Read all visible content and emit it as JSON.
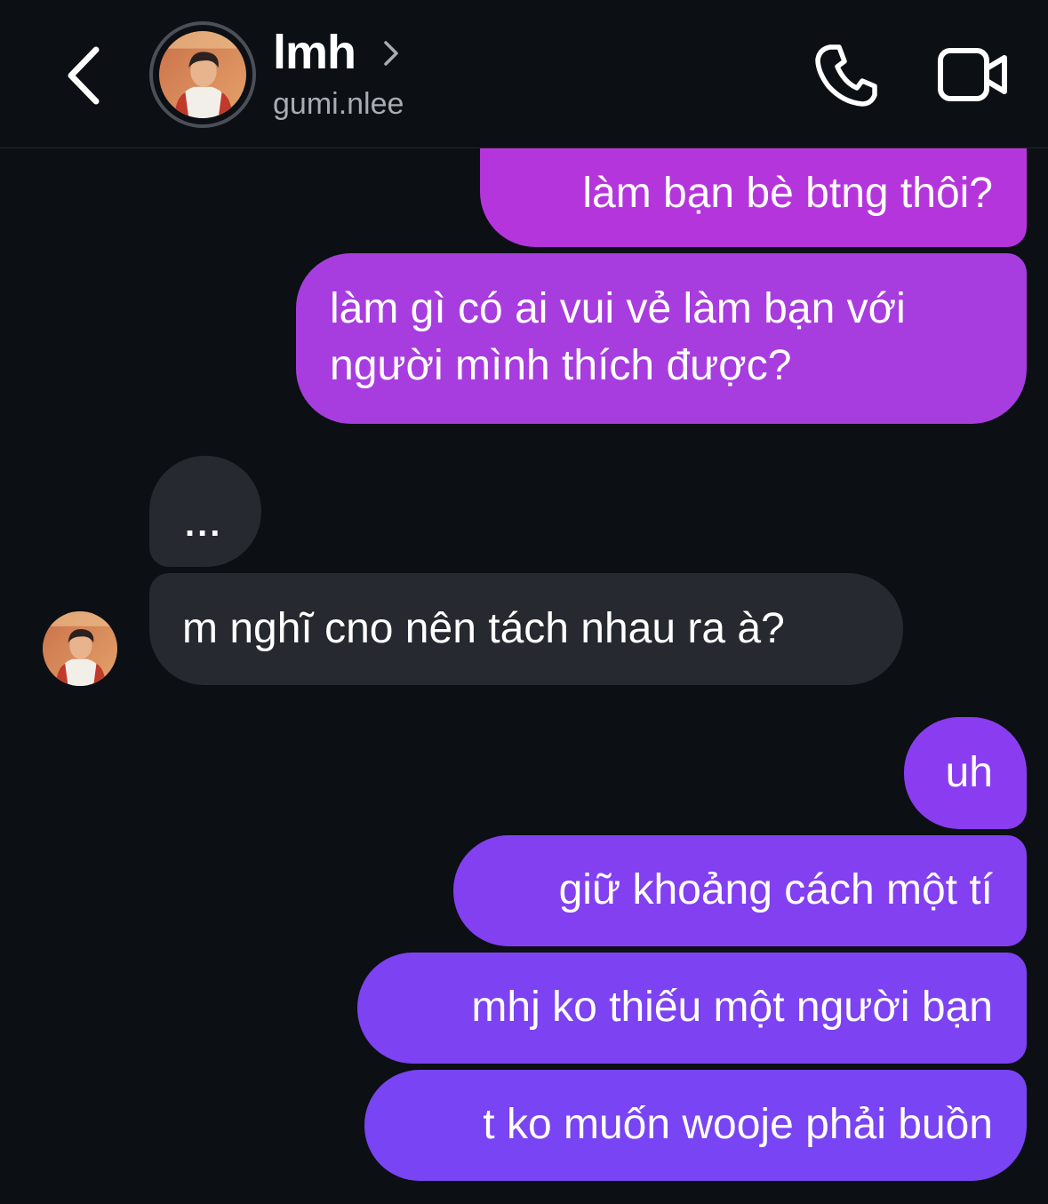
{
  "header": {
    "contact_name": "lmh",
    "contact_handle": "gumi.nlee",
    "back_icon": "chevron-left-icon",
    "name_chevron_icon": "chevron-right-icon",
    "call_icon": "phone-icon",
    "video_icon": "video-camera-icon"
  },
  "colors": {
    "background": "#0c0f14",
    "incoming_bubble": "#26292f",
    "outgoing_gradient_top": "#b535dc",
    "outgoing_gradient_bottom": "#7944f3",
    "secondary_text": "#a8acb3"
  },
  "messages": [
    {
      "direction": "outgoing",
      "text": "làm bạn bè btng thôi?"
    },
    {
      "direction": "outgoing",
      "text": "làm gì có ai vui vẻ làm bạn với\nngười mình thích được?"
    },
    {
      "direction": "incoming",
      "text": "..."
    },
    {
      "direction": "incoming",
      "text": "m nghĩ cno nên tách nhau ra à?"
    },
    {
      "direction": "outgoing",
      "text": "uh"
    },
    {
      "direction": "outgoing",
      "text": "giữ khoảng cách một tí"
    },
    {
      "direction": "outgoing",
      "text": "mhj ko thiếu một người bạn"
    },
    {
      "direction": "outgoing",
      "text": "t ko muốn wooje phải buồn"
    }
  ]
}
